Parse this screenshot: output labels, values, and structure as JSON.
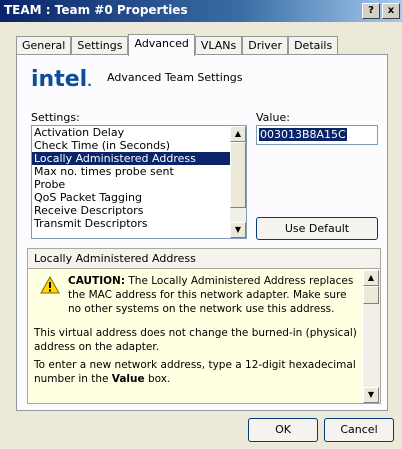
{
  "window": {
    "title": "TEAM : Team #0 Properties",
    "help_glyph": "?",
    "close_glyph": "x"
  },
  "tabs": [
    {
      "label": "General"
    },
    {
      "label": "Settings"
    },
    {
      "label": "Advanced"
    },
    {
      "label": "VLANs"
    },
    {
      "label": "Driver"
    },
    {
      "label": "Details"
    }
  ],
  "active_tab": "Advanced",
  "logo": {
    "text": "int",
    "suffix": "el",
    "dot": "."
  },
  "heading": "Advanced Team Settings",
  "settings": {
    "label": "Settings:",
    "items": [
      "Activation Delay",
      "Check Time (in Seconds)",
      "Locally Administered Address",
      "Max no. times probe sent",
      "Probe",
      "QoS Packet Tagging",
      "Receive Descriptors",
      "Transmit Descriptors"
    ],
    "selected": "Locally Administered Address"
  },
  "value": {
    "label": "Value:",
    "text": "003013B8A15C"
  },
  "use_default_label": "Use Default",
  "description": {
    "title": "Locally Administered Address",
    "caution_label": "CAUTION:",
    "caution_text": " The Locally Administered Address replaces the MAC address for this network adapter.  Make sure no other systems on the network use this address.",
    "p1": "This virtual address does not change the burned-in (physical) address on the adapter.",
    "p2_pre": "To enter a new network address, type a 12-digit hexadecimal number in the ",
    "p2_bold": "Value",
    "p2_post": " box."
  },
  "buttons": {
    "ok": "OK",
    "cancel": "Cancel"
  },
  "colors": {
    "selection": "#0a246a",
    "logo": "#0b4d9b",
    "desc_bg": "#ffffe1"
  }
}
